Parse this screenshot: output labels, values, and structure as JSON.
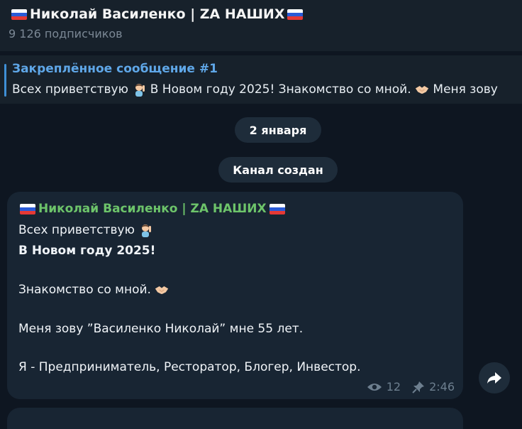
{
  "header": {
    "channel_name": "Николай Василенко | ZA НАШИХ",
    "subscribers": "9 126 подписчиков"
  },
  "pinned": {
    "title": "Закреплённое сообщение #1",
    "preview_part1": "Всех приветствую",
    "preview_part2": " В Новом году 2025!  Знакомство со мной.",
    "preview_part3": "  Меня зову"
  },
  "service": {
    "date": "2 января",
    "channel_created": "Канал создан"
  },
  "message": {
    "author": "Николай Василенко | ZA НАШИХ",
    "line1": "Всех приветствую",
    "line2": "В Новом году 2025!",
    "line3": "Знакомство со мной.",
    "line4": "Меня зову ”Василенко Николай” мне 55 лет.",
    "line5": "Я - Предприниматель, Ресторатор, Блогер, Инвестор.",
    "views": "12",
    "time": "2:46"
  },
  "icons": {
    "flag": "russian-flag-icon",
    "raise_hand": "person-raising-hand-icon",
    "handshake": "handshake-icon",
    "views": "eye-icon",
    "pin": "pin-icon",
    "share": "share-arrow-icon"
  },
  "colors": {
    "background": "#0e1621",
    "panel": "#17212b",
    "bubble": "#182533",
    "accent_blue": "#5fa7e8",
    "author_green": "#6dc46a"
  }
}
